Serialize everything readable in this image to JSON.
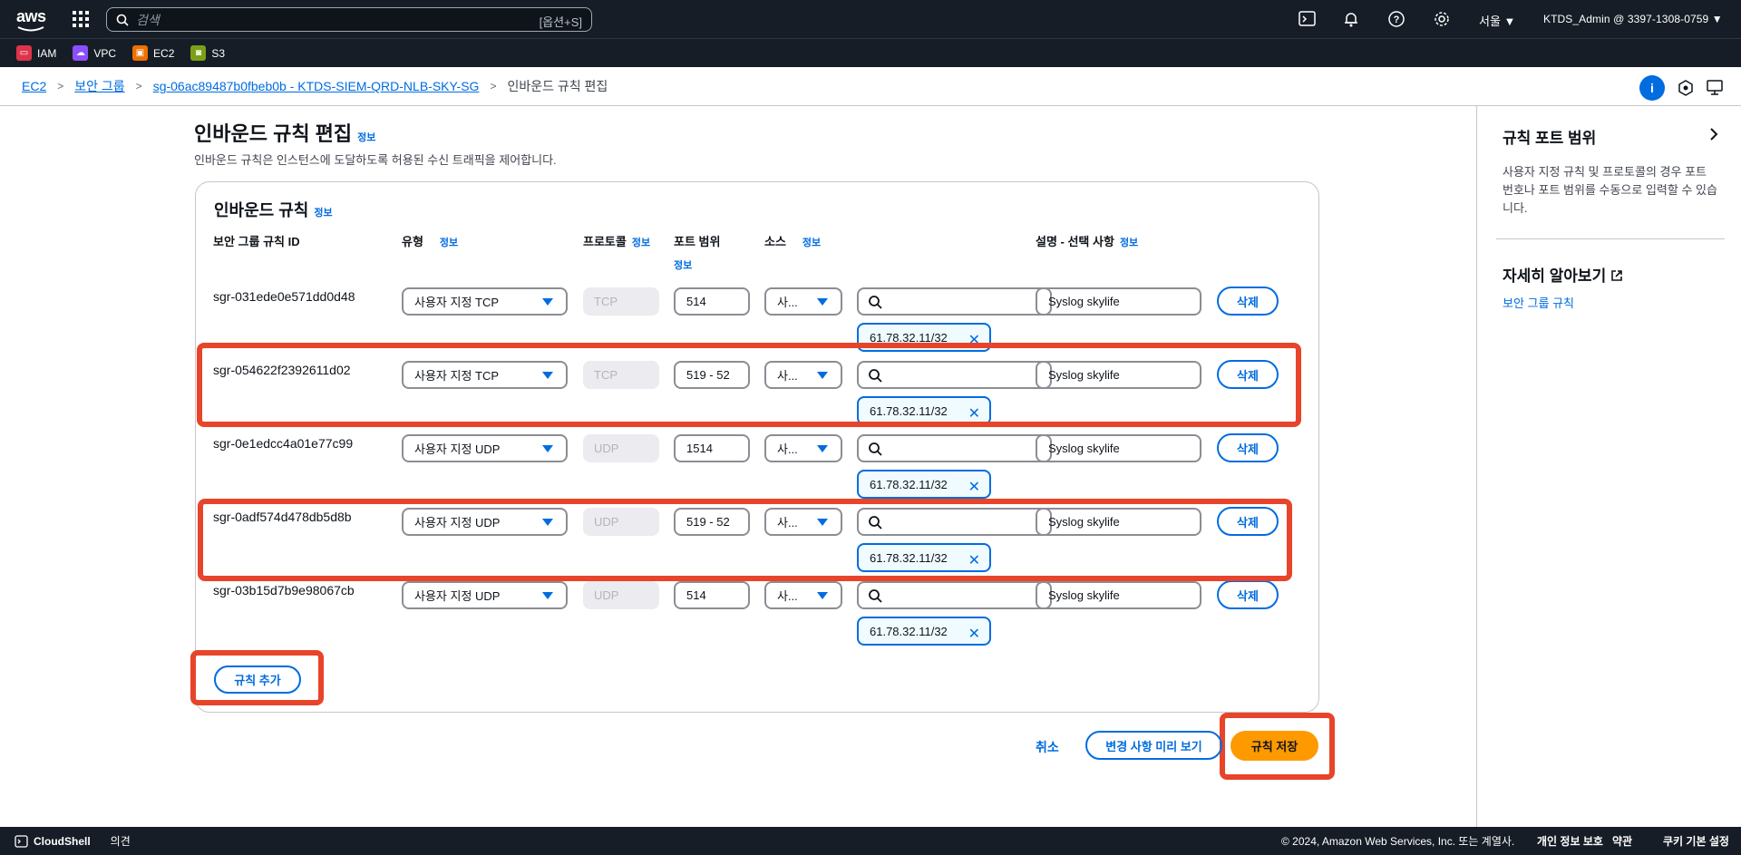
{
  "topbar": {
    "logo": "aws",
    "search_placeholder": "검색",
    "search_shortcut": "[옵션+S]",
    "region": "서울 ▼",
    "account": "KTDS_Admin @ 3397-1308-0759 ▼"
  },
  "favorites": [
    {
      "label": "IAM",
      "color": "#dd344c"
    },
    {
      "label": "VPC",
      "color": "#8c4fff"
    },
    {
      "label": "EC2",
      "color": "#ed7100"
    },
    {
      "label": "S3",
      "color": "#7aa116"
    }
  ],
  "breadcrumb": {
    "ec2": "EC2",
    "sg": "보안 그룹",
    "sg_detail": "sg-06ac89487b0fbeb0b - KTDS-SIEM-QRD-NLB-SKY-SG",
    "current": "인바운드 규칙 편집"
  },
  "page": {
    "title": "인바운드 규칙 편집",
    "info": "정보",
    "subtitle": "인바운드 규칙은 인스턴스에 도달하도록 허용된 수신 트래픽을 제어합니다."
  },
  "panel": {
    "title": "인바운드 규칙",
    "info": "정보",
    "columns": {
      "id": "보안 그룹 규칙 ID",
      "type": "유형",
      "protocol": "프로토콜",
      "port": "포트 범위",
      "source": "소스",
      "desc": "설명 - 선택 사항",
      "info": "정보"
    },
    "rules": [
      {
        "id": "sgr-031ede0e571dd0d48",
        "type": "사용자 지정 TCP",
        "protocol": "TCP",
        "port": "514",
        "source": "사...",
        "cidr": "61.78.32.11/32",
        "desc": "Syslog skylife",
        "delete": "삭제"
      },
      {
        "id": "sgr-054622f2392611d02",
        "type": "사용자 지정 TCP",
        "protocol": "TCP",
        "port": "519 - 52",
        "source": "사...",
        "cidr": "61.78.32.11/32",
        "desc": "Syslog skylife",
        "delete": "삭제"
      },
      {
        "id": "sgr-0e1edcc4a01e77c99",
        "type": "사용자 지정 UDP",
        "protocol": "UDP",
        "port": "1514",
        "source": "사...",
        "cidr": "61.78.32.11/32",
        "desc": "Syslog skylife",
        "delete": "삭제"
      },
      {
        "id": "sgr-0adf574d478db5d8b",
        "type": "사용자 지정 UDP",
        "protocol": "UDP",
        "port": "519 - 52",
        "source": "사...",
        "cidr": "61.78.32.11/32",
        "desc": "Syslog skylife",
        "delete": "삭제"
      },
      {
        "id": "sgr-03b15d7b9e98067cb",
        "type": "사용자 지정 UDP",
        "protocol": "UDP",
        "port": "514",
        "source": "사...",
        "cidr": "61.78.32.11/32",
        "desc": "Syslog skylife",
        "delete": "삭제"
      }
    ],
    "add_rule": "규칙 추가"
  },
  "actions": {
    "cancel": "취소",
    "preview": "변경 사항 미리 보기",
    "save": "규칙 저장"
  },
  "side": {
    "title": "규칙 포트 범위",
    "text": "사용자 지정 규칙 및 프로토콜의 경우 포트 번호나 포트 범위를 수동으로 입력할 수 있습니다.",
    "learn_more": "자세히 알아보기",
    "link": "보안 그룹 규칙"
  },
  "footer": {
    "cloudshell": "CloudShell",
    "feedback": "의견",
    "copyright": "© 2024, Amazon Web Services, Inc. 또는 계열사.",
    "privacy": "개인 정보 보호",
    "terms": "약관",
    "cookies": "쿠키 기본 설정"
  }
}
